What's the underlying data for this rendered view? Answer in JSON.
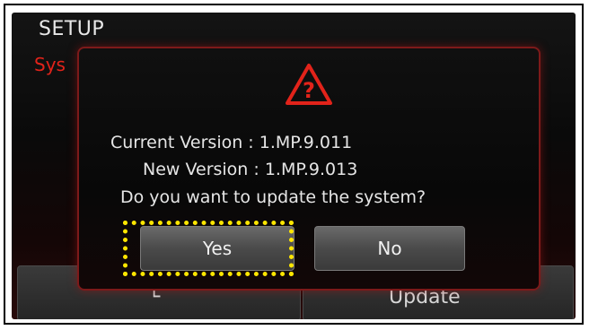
{
  "screen": {
    "title": "SETUP",
    "partial_label": "Sys"
  },
  "background_buttons": {
    "left_label": "└",
    "right_label": "Update"
  },
  "dialog": {
    "icon": "warning-question-icon",
    "current_version_line": "Current Version : 1.MP.9.011",
    "new_version_line": "New Version : 1.MP.9.013",
    "question": "Do you want to update the system?",
    "yes_label": "Yes",
    "no_label": "No"
  },
  "colors": {
    "accent_red": "#e2231a",
    "highlight_yellow": "#ffe600"
  }
}
